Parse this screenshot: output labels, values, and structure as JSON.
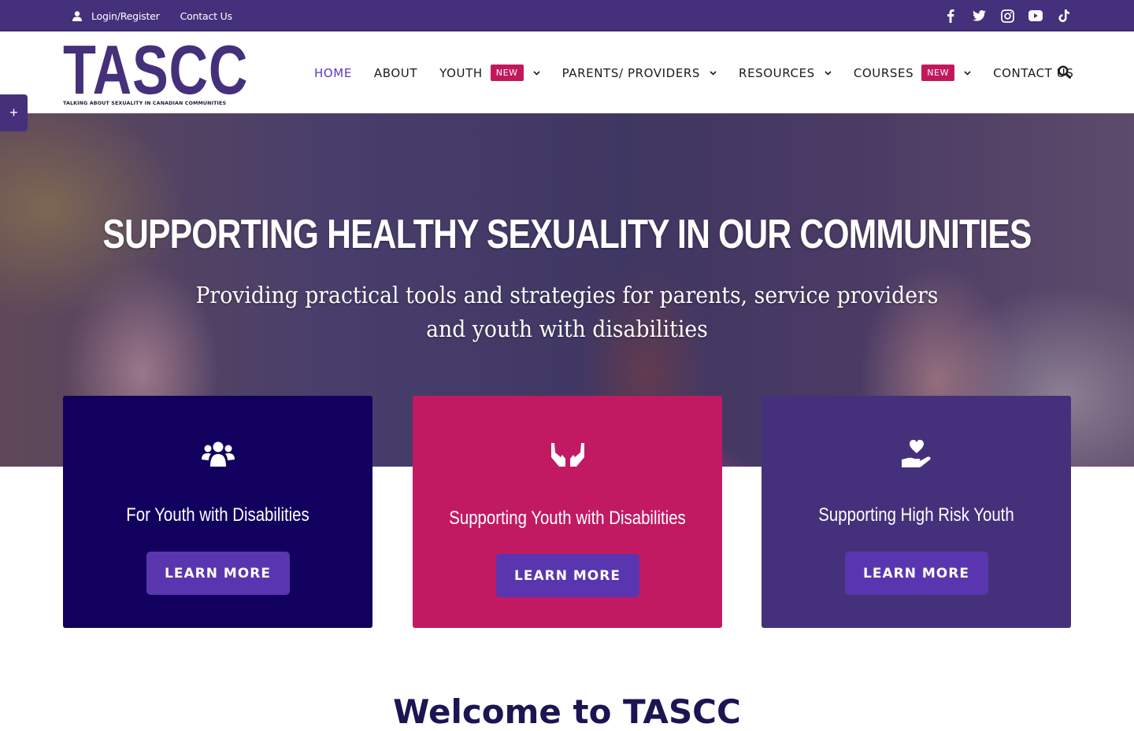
{
  "topbar": {
    "login_label": "Login/Register",
    "contact_label": "Contact Us",
    "social": [
      "facebook",
      "twitter",
      "instagram",
      "youtube",
      "tiktok"
    ]
  },
  "logo": {
    "wordmark": "TASCC",
    "tagline": "TALKING ABOUT SEXUALITY IN CANADIAN COMMUNITIES"
  },
  "nav": {
    "items": [
      {
        "label": "HOME",
        "active": true
      },
      {
        "label": "ABOUT"
      },
      {
        "label": "YOUTH",
        "badge": "NEW",
        "dropdown": true
      },
      {
        "label": "PARENTS/ PROVIDERS",
        "dropdown": true
      },
      {
        "label": "RESOURCES",
        "dropdown": true
      },
      {
        "label": "COURSES",
        "badge": "NEW",
        "dropdown": true
      },
      {
        "label": "CONTACT US"
      }
    ]
  },
  "side_tab": {
    "label": "+"
  },
  "hero": {
    "title": "SUPPORTING HEALTHY SEXUALITY IN OUR COMMUNITIES",
    "subtitle": "Providing practical tools and strategies for parents, service providers and youth with disabilities"
  },
  "cards": [
    {
      "icon": "users-icon",
      "title": "For Youth with Disabilities",
      "button": "LEARN MORE",
      "color": "#11005e"
    },
    {
      "icon": "hands-icon",
      "title": "Supporting Youth with Disabilities",
      "button": "LEARN MORE",
      "color": "#c21a62"
    },
    {
      "icon": "hand-holding-heart-icon",
      "title": "Supporting High Risk Youth",
      "button": "LEARN MORE",
      "color": "#45307c"
    }
  ],
  "welcome": {
    "heading": "Welcome to TASCC"
  },
  "colors": {
    "brand_purple": "#45307c",
    "accent_pink": "#c2185b",
    "button_purple": "#5a35b0",
    "navy": "#11005e"
  }
}
